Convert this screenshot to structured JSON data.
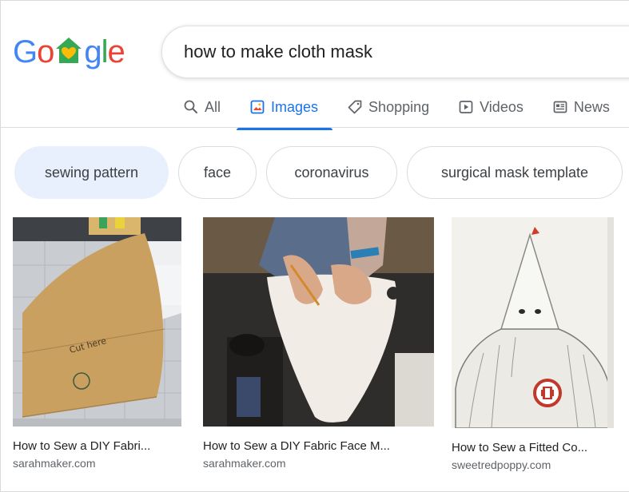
{
  "search": {
    "query": "how to make cloth mask"
  },
  "tabs": [
    {
      "label": "All",
      "icon": "search-icon"
    },
    {
      "label": "Images",
      "icon": "image-icon",
      "active": true
    },
    {
      "label": "Shopping",
      "icon": "tag-icon"
    },
    {
      "label": "Videos",
      "icon": "play-icon"
    },
    {
      "label": "News",
      "icon": "news-icon"
    }
  ],
  "chips": [
    {
      "label": "sewing pattern",
      "active": true
    },
    {
      "label": "face"
    },
    {
      "label": "coronavirus"
    },
    {
      "label": "surgical mask template"
    }
  ],
  "results": [
    {
      "title": "How to Sew a DIY Fabri...",
      "source": "sarahmaker.com"
    },
    {
      "title": "How to Sew a DIY Fabric Face M...",
      "source": "sarahmaker.com"
    },
    {
      "title": "How to Sew a Fitted Co...",
      "source": "sweetredpoppy.com"
    }
  ],
  "colors": {
    "accent": "#1a73e8",
    "logo_blue": "#4285f4",
    "logo_red": "#ea4335",
    "logo_yellow": "#fbbc05",
    "logo_green": "#34a853"
  }
}
